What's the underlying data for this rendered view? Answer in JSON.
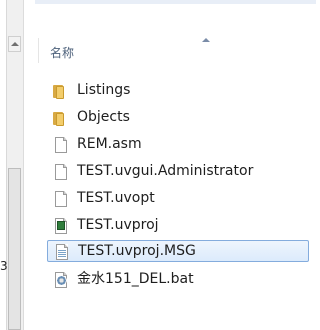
{
  "nav": {
    "cutoff_text": "3"
  },
  "header": {
    "name_label": "名称"
  },
  "files": [
    {
      "name": "Listings",
      "icon": "folder-icon",
      "selected": false
    },
    {
      "name": "Objects",
      "icon": "folder-icon",
      "selected": false
    },
    {
      "name": "REM.asm",
      "icon": "file-icon",
      "selected": false
    },
    {
      "name": "TEST.uvgui.Administrator",
      "icon": "file-icon",
      "selected": false
    },
    {
      "name": "TEST.uvopt",
      "icon": "file-icon",
      "selected": false
    },
    {
      "name": "TEST.uvproj",
      "icon": "uvproj-file-icon",
      "selected": false
    },
    {
      "name": "TEST.uvproj.MSG",
      "icon": "text-document-icon",
      "selected": true
    },
    {
      "name": "金水151_DEL.bat",
      "icon": "batch-file-icon",
      "selected": false
    }
  ]
}
